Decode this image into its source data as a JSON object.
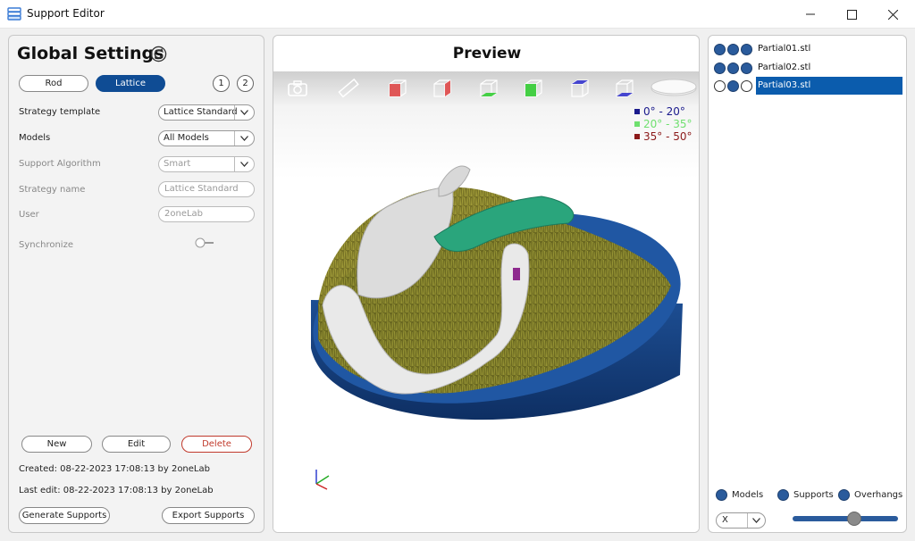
{
  "window": {
    "title": "Support Editor"
  },
  "global_settings": {
    "title": "Global Settings",
    "modes": [
      "Rod",
      "Lattice"
    ],
    "active_mode": "Lattice",
    "pages": [
      "1",
      "2"
    ],
    "rows": {
      "strategy_template": {
        "label": "Strategy template",
        "value": "Lattice Standard"
      },
      "models": {
        "label": "Models",
        "value": "All Models"
      },
      "support_algorithm": {
        "label": "Support Algorithm",
        "value": "Smart"
      },
      "strategy_name": {
        "label": "Strategy name",
        "value": "Lattice Standard"
      },
      "user": {
        "label": "User",
        "value": "2oneLab"
      },
      "synchronize": {
        "label": "Synchronize"
      }
    },
    "buttons": {
      "new": "New",
      "edit": "Edit",
      "delete": "Delete",
      "generate": "Generate Supports",
      "export": "Export Supports"
    },
    "created": "Created: 08-22-2023 17:08:13 by 2oneLab",
    "last_edit": "Last edit: 08-22-2023 17:08:13 by 2oneLab"
  },
  "preview": {
    "title": "Preview",
    "toolbar": [
      "camera-icon",
      "ruler-icon",
      "view-red-cube-icon",
      "view-red-cube-icon",
      "view-green-cube-icon",
      "view-green-cube-icon",
      "view-blue-cube-icon",
      "view-blue-cube-icon",
      "build-plate-icon"
    ],
    "legend": [
      {
        "label": "0° - 20°",
        "color": "#1a1a8c"
      },
      {
        "label": "20° - 35°",
        "color": "#6fe06f"
      },
      {
        "label": "35° - 50°",
        "color": "#8c1a1a"
      }
    ],
    "colors": {
      "plate": "#1f4f95",
      "supports": "#7d7a1e",
      "model": "#e8e8e8",
      "green_model": "#2aa57c"
    }
  },
  "files": [
    {
      "name": "Partial01.stl",
      "dots": [
        true,
        true,
        true
      ],
      "selected": false
    },
    {
      "name": "Partial02.stl",
      "dots": [
        true,
        true,
        true
      ],
      "selected": false
    },
    {
      "name": "Partial03.stl",
      "dots": [
        false,
        true,
        false
      ],
      "selected": true
    }
  ],
  "visibility": {
    "models": "Models",
    "supports": "Supports",
    "overhangs": "Overhangs"
  },
  "axis": {
    "value": "X"
  },
  "slider": {
    "value": 0.6
  }
}
